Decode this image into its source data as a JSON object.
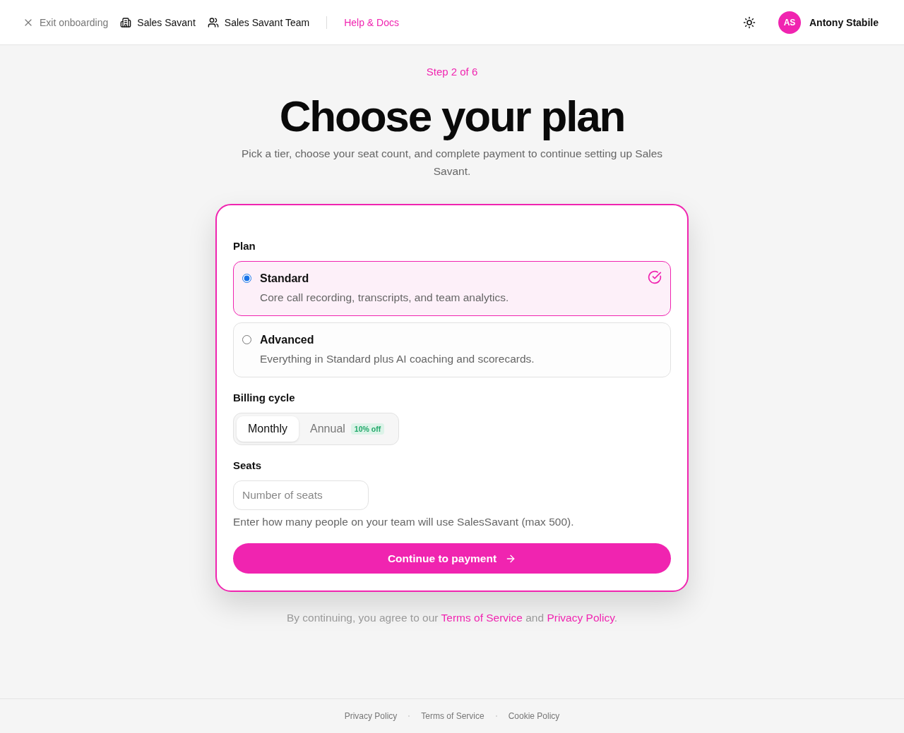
{
  "header": {
    "exit_label": "Exit onboarding",
    "nav": [
      {
        "kind": "building",
        "label": "Sales Savant"
      },
      {
        "kind": "team",
        "label": "Sales Savant Team"
      }
    ],
    "help_link": "Help & Docs",
    "user": {
      "initials": "AS",
      "name": "Antony Stabile"
    }
  },
  "intro": {
    "step": "Step 2 of 6",
    "title": "Choose your plan",
    "subtitle": "Pick a tier, choose your seat count, and complete payment to continue setting up Sales Savant."
  },
  "form": {
    "plan_label": "Plan",
    "plans": [
      {
        "name": "Standard",
        "description": "Core call recording, transcripts, and team analytics.",
        "selected": true
      },
      {
        "name": "Advanced",
        "description": "Everything in Standard plus AI coaching and scorecards.",
        "selected": false
      }
    ],
    "billing_label": "Billing cycle",
    "billing_options": [
      {
        "label": "Monthly",
        "selected": true
      },
      {
        "label": "Annual",
        "badge": "10% off",
        "selected": false
      }
    ],
    "seats_label": "Seats",
    "seats_placeholder": "Number of seats",
    "seats_hint": "Enter how many people on your team will use SalesSavant (max 500).",
    "submit": "Continue to payment"
  },
  "consent": [
    {
      "kind": "text",
      "text": "By continuing, you agree to our "
    },
    {
      "kind": "link",
      "text": "Terms of Service"
    },
    {
      "kind": "text",
      "text": " and "
    },
    {
      "kind": "link",
      "text": "Privacy Policy"
    },
    {
      "kind": "text",
      "text": "."
    }
  ],
  "footer": {
    "links": [
      "Privacy Policy",
      "Terms of Service",
      "Cookie Policy"
    ]
  }
}
